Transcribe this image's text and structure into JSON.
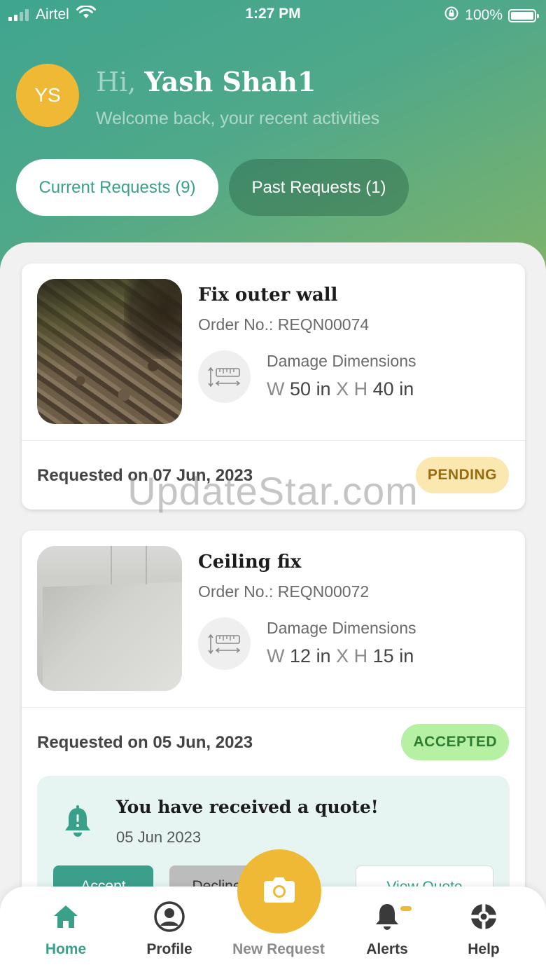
{
  "status_bar": {
    "carrier": "Airtel",
    "time": "1:27 PM",
    "battery": "100%"
  },
  "user": {
    "initials": "YS",
    "greeting_prefix": "Hi,",
    "name": "Yash Shah1",
    "welcome": "Welcome back, your recent activities"
  },
  "tabs": {
    "current": "Current Requests (9)",
    "past": "Past Requests (1)"
  },
  "requests": [
    {
      "title": "Fix outer wall",
      "order_no": "Order No.: REQN00074",
      "dim_label": "Damage Dimensions",
      "w_prefix": "W",
      "w_value": "50",
      "w_unit": "in",
      "sep": "X",
      "h_prefix": "H",
      "h_value": "40",
      "h_unit": "in",
      "requested": "Requested on 07 Jun, 2023",
      "status": "PENDING"
    },
    {
      "title": "Ceiling fix",
      "order_no": "Order No.: REQN00072",
      "dim_label": "Damage Dimensions",
      "w_prefix": "W",
      "w_value": "12",
      "w_unit": "in",
      "sep": "X",
      "h_prefix": "H",
      "h_value": "15",
      "h_unit": "in",
      "requested": "Requested on 05 Jun, 2023",
      "status": "ACCEPTED"
    }
  ],
  "quote": {
    "title": "You have received a quote!",
    "date": "05 Jun 2023",
    "accept": "Accept",
    "decline": "Decline",
    "view": "View Quote"
  },
  "watermark": "UpdateStar.com",
  "nav": {
    "home": "Home",
    "profile": "Profile",
    "new_request": "New Request",
    "alerts": "Alerts",
    "help": "Help"
  },
  "colors": {
    "primary": "#3aa08a",
    "accent": "#efb935",
    "pending_bg": "#fbe7b0",
    "accepted_bg": "#b6f0a3"
  },
  "icons": [
    "wifi-icon",
    "lock-rotation-icon",
    "battery-icon",
    "ruler-dimensions-icon",
    "bell-icon",
    "home-icon",
    "profile-icon",
    "camera-icon",
    "help-icon"
  ]
}
